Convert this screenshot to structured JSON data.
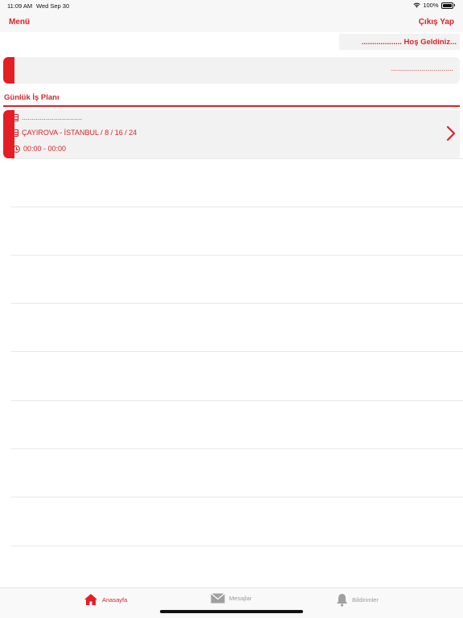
{
  "status_bar": {
    "time": "11:09 AM",
    "date": "Wed Sep 30",
    "battery": "100%"
  },
  "nav": {
    "menu_label": "Menü",
    "logout_label": "Çıkış Yap"
  },
  "welcome": {
    "text": "................... Hoş Geldiniz..."
  },
  "info_card": {
    "text": "..............................."
  },
  "section": {
    "title": "Günlük İş Planı"
  },
  "plan_item": {
    "name": "..............................",
    "location": "ÇAYIROVA - İSTANBUL / 8 / 16 / 24",
    "time": "00:00 - 00:00"
  },
  "tabs": [
    {
      "label": "Anasayfa",
      "icon": "home-icon"
    },
    {
      "label": "Mesajlar",
      "icon": "mail-icon"
    },
    {
      "label": "Bildirimler",
      "icon": "bell-icon"
    }
  ],
  "colors": {
    "accent": "#d9232a",
    "card_bg": "#f2f2f2",
    "inactive": "#9a9a9a"
  }
}
